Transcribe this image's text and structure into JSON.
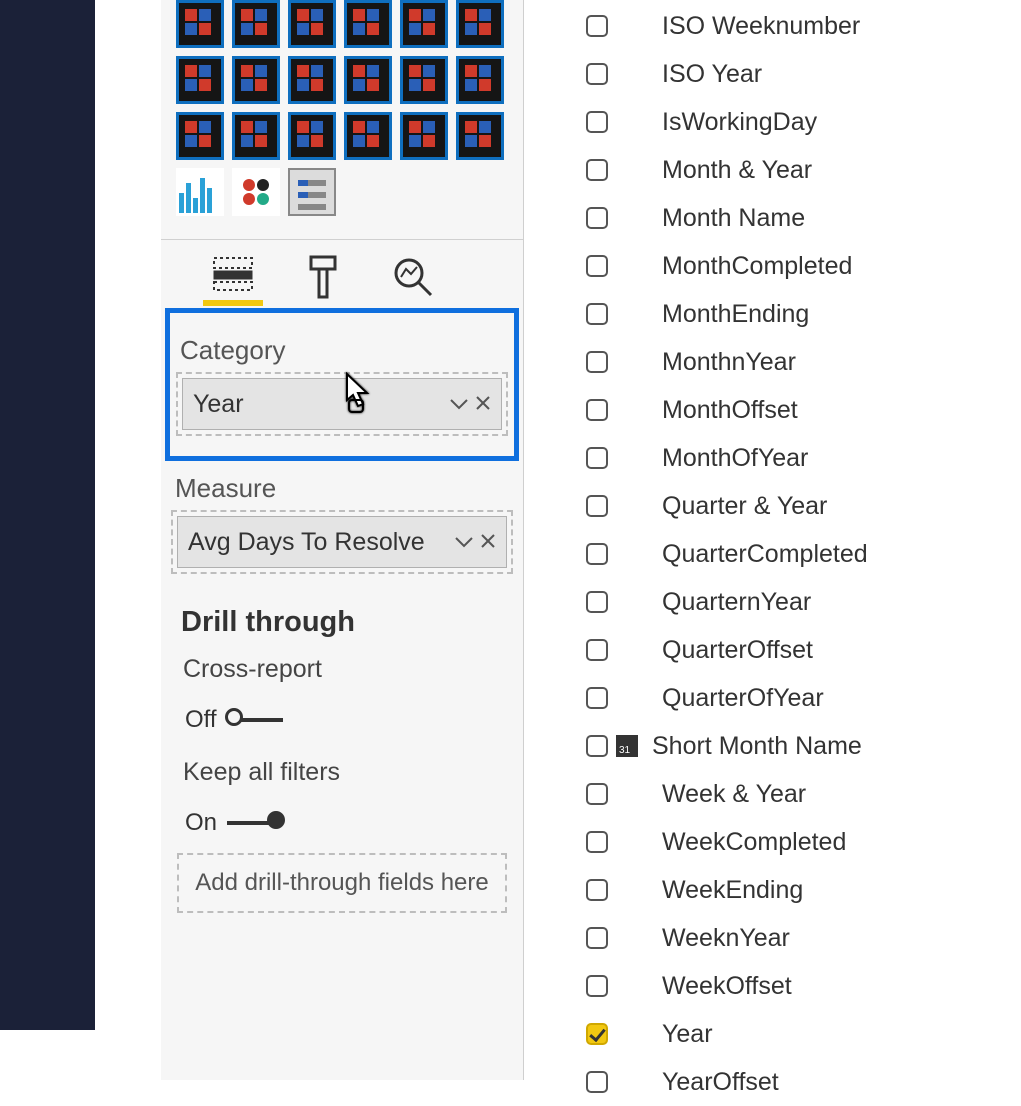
{
  "wells": {
    "category_label": "Category",
    "category_field": "Year",
    "measure_label": "Measure",
    "measure_field": "Avg Days To Resolve"
  },
  "drill": {
    "heading": "Drill through",
    "cross_report_label": "Cross-report",
    "cross_report_state": "Off",
    "keep_filters_label": "Keep all filters",
    "keep_filters_state": "On",
    "drop_hint": "Add drill-through fields here"
  },
  "fields": [
    {
      "name": "ISO Weeknumber",
      "checked": false,
      "icon": false
    },
    {
      "name": "ISO Year",
      "checked": false,
      "icon": false
    },
    {
      "name": "IsWorkingDay",
      "checked": false,
      "icon": false
    },
    {
      "name": "Month & Year",
      "checked": false,
      "icon": false
    },
    {
      "name": "Month Name",
      "checked": false,
      "icon": false
    },
    {
      "name": "MonthCompleted",
      "checked": false,
      "icon": false
    },
    {
      "name": "MonthEnding",
      "checked": false,
      "icon": false
    },
    {
      "name": "MonthnYear",
      "checked": false,
      "icon": false
    },
    {
      "name": "MonthOffset",
      "checked": false,
      "icon": false
    },
    {
      "name": "MonthOfYear",
      "checked": false,
      "icon": false
    },
    {
      "name": "Quarter & Year",
      "checked": false,
      "icon": false
    },
    {
      "name": "QuarterCompleted",
      "checked": false,
      "icon": false
    },
    {
      "name": "QuarternYear",
      "checked": false,
      "icon": false
    },
    {
      "name": "QuarterOffset",
      "checked": false,
      "icon": false
    },
    {
      "name": "QuarterOfYear",
      "checked": false,
      "icon": false
    },
    {
      "name": "Short Month Name",
      "checked": false,
      "icon": true
    },
    {
      "name": "Week & Year",
      "checked": false,
      "icon": false
    },
    {
      "name": "WeekCompleted",
      "checked": false,
      "icon": false
    },
    {
      "name": "WeekEnding",
      "checked": false,
      "icon": false
    },
    {
      "name": "WeeknYear",
      "checked": false,
      "icon": false
    },
    {
      "name": "WeekOffset",
      "checked": false,
      "icon": false
    },
    {
      "name": "Year",
      "checked": true,
      "icon": false
    },
    {
      "name": "YearOffset",
      "checked": false,
      "icon": false
    }
  ]
}
